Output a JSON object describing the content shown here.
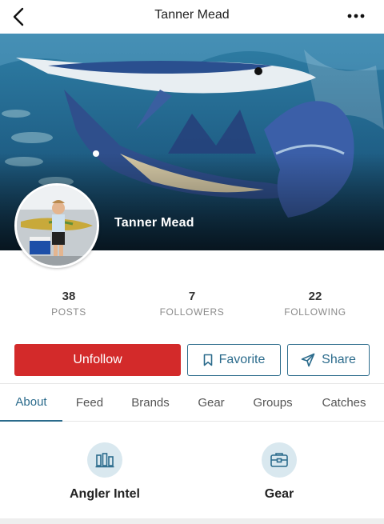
{
  "header": {
    "title": "Tanner Mead",
    "back_icon": "chevron-left-icon",
    "more_icon": "more-horizontal-icon"
  },
  "profile": {
    "name": "Tanner Mead"
  },
  "stats": [
    {
      "value": "38",
      "label": "POSTS"
    },
    {
      "value": "7",
      "label": "FOLLOWERS"
    },
    {
      "value": "22",
      "label": "FOLLOWING"
    }
  ],
  "actions": {
    "unfollow_label": "Unfollow",
    "favorite_label": "Favorite",
    "share_label": "Share"
  },
  "tabs": [
    {
      "label": "About",
      "active": true
    },
    {
      "label": "Feed"
    },
    {
      "label": "Brands"
    },
    {
      "label": "Gear"
    },
    {
      "label": "Groups"
    },
    {
      "label": "Catches"
    }
  ],
  "tiles": [
    {
      "label": "Angler Intel",
      "icon": "bar-chart-icon"
    },
    {
      "label": "Gear",
      "icon": "tackle-box-icon"
    }
  ],
  "colors": {
    "accent": "#2b6b8c",
    "unfollow": "#d32a2a",
    "tile_circle": "#d9e8ef"
  }
}
